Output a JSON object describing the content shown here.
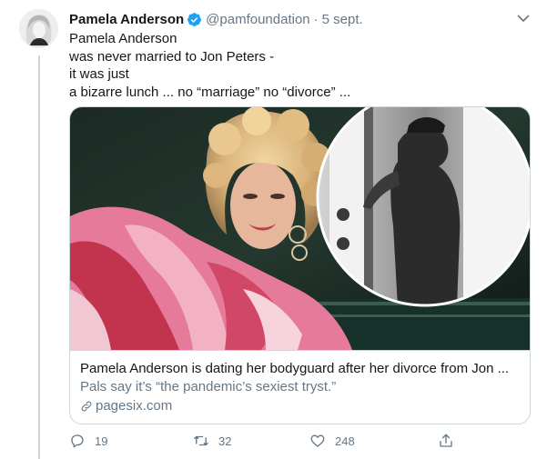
{
  "tweet": {
    "author_name": "Pamela Anderson",
    "handle": "@pamfoundation",
    "separator": "·",
    "date": "5 sept.",
    "text_lines": [
      "Pamela Anderson",
      "was never married to Jon Peters -",
      "it was just",
      "a bizarre lunch ... no “marriage” no “divorce” ..."
    ]
  },
  "card": {
    "title": "Pamela Anderson is dating her bodyguard after her divorce from Jon ...",
    "description": "Pals say it’s “the pandemic’s sexiest tryst.”",
    "domain": "pagesix.com"
  },
  "actions": {
    "reply_count": "19",
    "retweet_count": "32",
    "like_count": "248"
  },
  "icons": {
    "verified": "verified-badge-icon",
    "caret": "chevron-down-icon",
    "link": "link-icon",
    "reply": "reply-icon",
    "retweet": "retweet-icon",
    "like": "heart-icon",
    "share": "share-icon"
  },
  "colors": {
    "accent": "#1da1f2",
    "secondary_text": "#657786",
    "border": "#ccd6dd"
  }
}
